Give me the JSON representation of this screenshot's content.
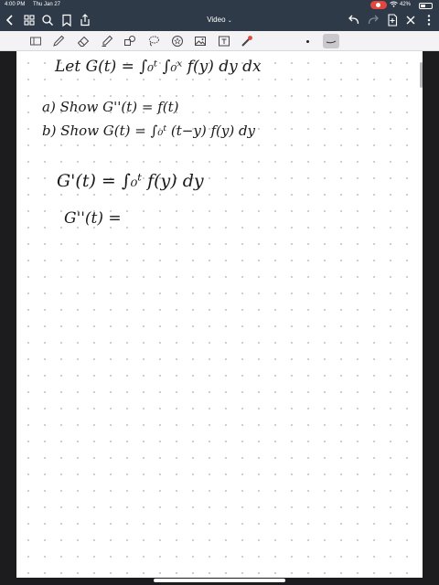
{
  "status": {
    "time": "4:00 PM",
    "date": "Thu Jan 27",
    "battery": "42%"
  },
  "nav": {
    "title": "Video",
    "title_chevron": "⌄"
  },
  "colors": {
    "topbar": "#2f3a48",
    "toolbar": "#f3f3f5",
    "recording": "#e2463f",
    "ink": "#1a1a1a"
  },
  "toolbar": {
    "tools": [
      "sidebar-toggle",
      "pen",
      "eraser",
      "highlighter",
      "shapes",
      "lasso",
      "star",
      "image",
      "text",
      "laser-pointer"
    ],
    "stroke_color": "black"
  },
  "note": {
    "line1": "Let G(t) = ∫₀ᵗ ∫₀ˣ f(y) dy dx",
    "line2": "a) Show G''(t) = f(t)",
    "line3": "b) Show G(t) = ∫₀ᵗ (t−y) f(y) dy",
    "line4": "G'(t) = ∫₀ᵗ f(y) dy",
    "line5": "G''(t) ="
  }
}
